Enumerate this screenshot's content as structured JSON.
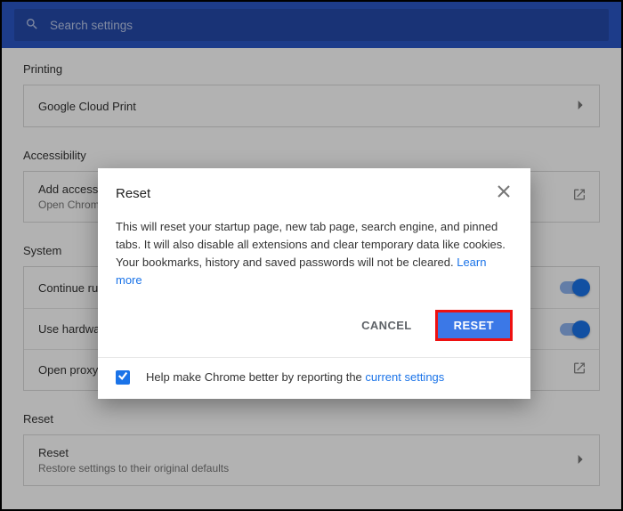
{
  "search": {
    "placeholder": "Search settings"
  },
  "sections": {
    "printing": {
      "header": "Printing",
      "cloud_print": "Google Cloud Print"
    },
    "accessibility": {
      "header": "Accessibility",
      "add_label": "Add accessibility features",
      "add_sub": "Open Chrome Web Store"
    },
    "system": {
      "header": "System",
      "r1": "Continue running background apps when Google Chrome is closed",
      "r2": "Use hardware acceleration when available",
      "r3": "Open proxy settings"
    },
    "reset": {
      "header": "Reset",
      "label": "Reset",
      "sub": "Restore settings to their original defaults"
    }
  },
  "dialog": {
    "title": "Reset",
    "body_pre": "This will reset your startup page, new tab page, search engine, and pinned tabs. It will also disable all extensions and clear temporary data like cookies. Your bookmarks, history and saved passwords will not be cleared. ",
    "learn_more": "Learn more",
    "cancel": "CANCEL",
    "confirm": "RESET",
    "footer_pre": "Help make Chrome better by reporting the ",
    "footer_link": "current settings"
  }
}
